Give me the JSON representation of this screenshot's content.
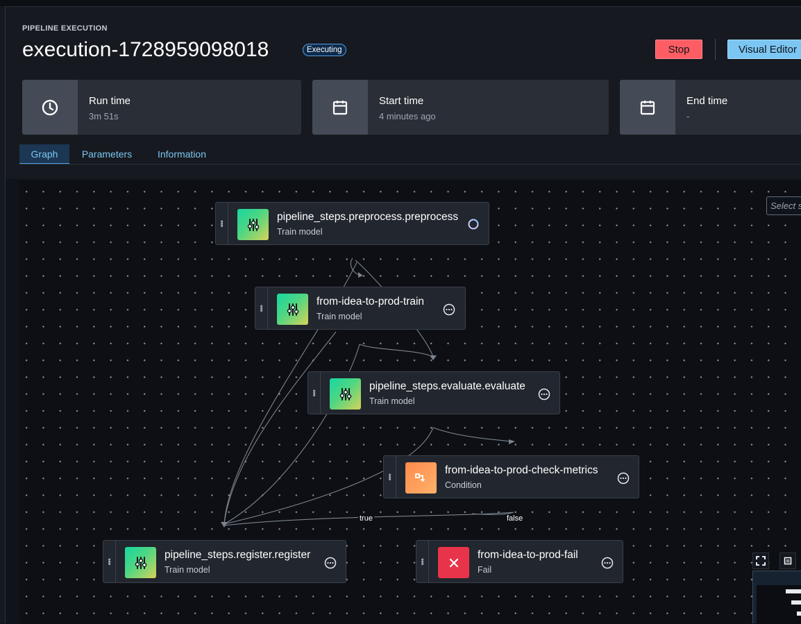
{
  "header": {
    "eyebrow": "PIPELINE EXECUTION",
    "title": "execution-1728959098018",
    "status_badge": "Executing",
    "stop_label": "Stop",
    "visual_editor_label": "Visual Editor"
  },
  "cards": [
    {
      "title": "Run time",
      "value": "3m 51s",
      "icon": "clock-icon"
    },
    {
      "title": "Start time",
      "value": "4 minutes ago",
      "icon": "calendar-icon"
    },
    {
      "title": "End time",
      "value": "-",
      "icon": "calendar-icon"
    }
  ],
  "tabs": [
    {
      "label": "Graph",
      "active": true
    },
    {
      "label": "Parameters",
      "active": false
    },
    {
      "label": "Information",
      "active": false
    }
  ],
  "graph": {
    "select_placeholder": "Select s",
    "nodes": [
      {
        "name": "pipeline_steps.preprocess.preprocess",
        "type": "Train model",
        "status": "in-progress"
      },
      {
        "name": "from-idea-to-prod-train",
        "type": "Train model",
        "status": "pending"
      },
      {
        "name": "pipeline_steps.evaluate.evaluate",
        "type": "Train model",
        "status": "pending"
      },
      {
        "name": "from-idea-to-prod-check-metrics",
        "type": "Condition",
        "status": "pending"
      },
      {
        "name": "pipeline_steps.register.register",
        "type": "Train model",
        "status": "pending"
      },
      {
        "name": "from-idea-to-prod-fail",
        "type": "Fail",
        "status": "pending"
      }
    ],
    "edge_labels": {
      "true_label": "true",
      "false_label": "false"
    }
  },
  "colors": {
    "accent": "#539fe5",
    "stop_button": "#ff5d64",
    "visual_editor_button": "#7cc6f3",
    "graph_background": "#0d0f14"
  }
}
